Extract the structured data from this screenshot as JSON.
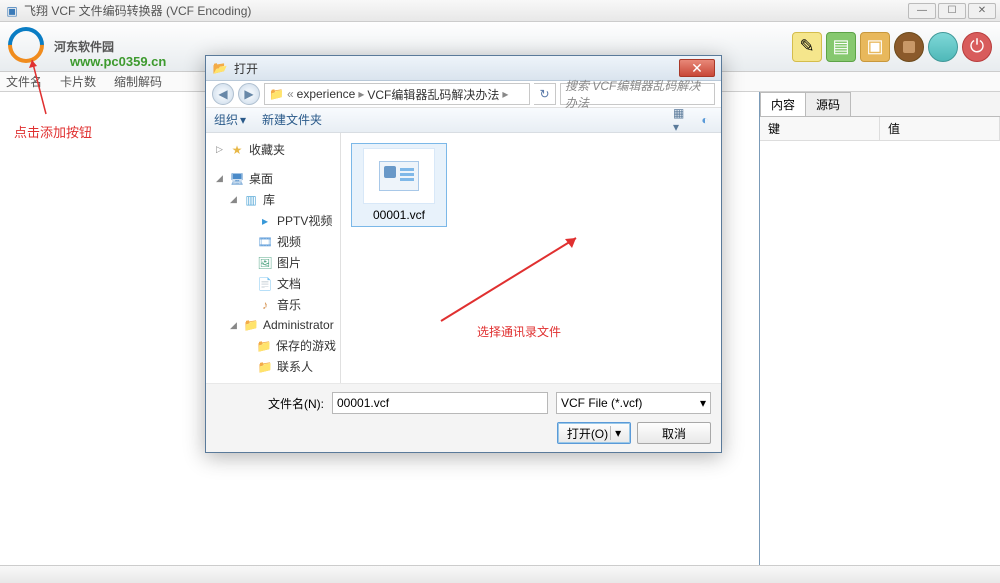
{
  "window": {
    "title": "飞翔 VCF 文件编码转换器 (VCF Encoding)",
    "min": "—",
    "max": "☐",
    "close": "✕"
  },
  "logo": {
    "text": "河东软件园",
    "url": "www.pc0359.cn"
  },
  "separator": {
    "col1": "文件名",
    "col2": "卡片数",
    "col3": "缩制解码"
  },
  "annotations": {
    "addBtn": "点击添加按钮",
    "selectFile": "选择通讯录文件"
  },
  "rightPane": {
    "tabs": {
      "content": "内容",
      "source": "源码"
    },
    "headers": {
      "key": "键",
      "value": "值"
    }
  },
  "dialog": {
    "title": "打开",
    "back": "◀",
    "fwd": "▶",
    "path": {
      "sep1": "«",
      "seg1": "experience",
      "seg2": "VCF编辑器乱码解决办法",
      "arrow": "▸"
    },
    "searchPlaceholder": "搜索 VCF编辑器乱码解决办法",
    "toolbar": {
      "organize": "组织",
      "newFolder": "新建文件夹"
    },
    "tree": [
      {
        "id": "fav",
        "label": "收藏夹",
        "icon": "star",
        "indent": 0,
        "caret": "▷"
      },
      {
        "id": "desktop",
        "label": "桌面",
        "icon": "desktop",
        "indent": 0,
        "caret": "◢"
      },
      {
        "id": "lib",
        "label": "库",
        "icon": "lib",
        "indent": 1,
        "caret": "◢"
      },
      {
        "id": "pptv",
        "label": "PPTV视频",
        "icon": "pptv",
        "indent": 2,
        "caret": ""
      },
      {
        "id": "video",
        "label": "视频",
        "icon": "video",
        "indent": 2,
        "caret": ""
      },
      {
        "id": "pic",
        "label": "图片",
        "icon": "pic",
        "indent": 2,
        "caret": ""
      },
      {
        "id": "doc",
        "label": "文档",
        "icon": "doc",
        "indent": 2,
        "caret": ""
      },
      {
        "id": "music",
        "label": "音乐",
        "icon": "music",
        "indent": 2,
        "caret": ""
      },
      {
        "id": "admin",
        "label": "Administrator",
        "icon": "user",
        "indent": 1,
        "caret": "◢"
      },
      {
        "id": "games",
        "label": "保存的游戏",
        "icon": "fold",
        "indent": 2,
        "caret": ""
      },
      {
        "id": "contacts",
        "label": "联系人",
        "icon": "fold",
        "indent": 2,
        "caret": ""
      }
    ],
    "file": {
      "name": "00001.vcf"
    },
    "footer": {
      "fnameLabel": "文件名(N):",
      "fnameValue": "00001.vcf",
      "ftype": "VCF File (*.vcf)",
      "open": "打开(O)",
      "cancel": "取消",
      "dropdown": "▾",
      "splitArrow": "▾"
    }
  }
}
